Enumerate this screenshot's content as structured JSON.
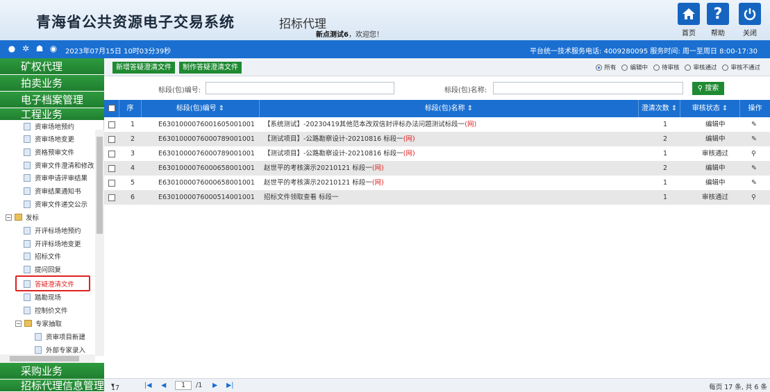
{
  "header": {
    "system_title": "青海省公共资源电子交易系统",
    "sub_title": "招标代理",
    "welcome_user": "新点测试6",
    "welcome_suffix": "，欢迎您！",
    "buttons": [
      {
        "label": "首页",
        "icon": "home-icon"
      },
      {
        "label": "帮助",
        "icon": "help-icon"
      },
      {
        "label": "关闭",
        "icon": "power-icon"
      }
    ]
  },
  "infobar": {
    "datetime": "2023年07月15日 10时03分39秒",
    "service": "平台统一技术服务电话: 4009280095 服务时间: 周一至周日 8:00-17:30"
  },
  "nav": {
    "sections_top": [
      "矿权代理",
      "拍卖业务",
      "电子档案管理",
      "工程业务"
    ],
    "sections_bottom": [
      "采购业务",
      "招标代理信息管理"
    ],
    "tree": [
      {
        "label": "资审场地预约",
        "type": "doc",
        "indent": 1
      },
      {
        "label": "资审场地变更",
        "type": "doc",
        "indent": 1
      },
      {
        "label": "资格预审文件",
        "type": "doc",
        "indent": 1
      },
      {
        "label": "资审文件澄清和修改",
        "type": "doc",
        "indent": 1
      },
      {
        "label": "资审申请评审结果",
        "type": "doc",
        "indent": 1
      },
      {
        "label": "资审结果通知书",
        "type": "doc",
        "indent": 1
      },
      {
        "label": "资审文件递交公示",
        "type": "doc",
        "indent": 1
      },
      {
        "label": "发标",
        "type": "folder",
        "indent": 0
      },
      {
        "label": "开评标场地预约",
        "type": "doc",
        "indent": 1
      },
      {
        "label": "开评标场地变更",
        "type": "doc",
        "indent": 1
      },
      {
        "label": "招标文件",
        "type": "doc",
        "indent": 1
      },
      {
        "label": "提问回复",
        "type": "doc",
        "indent": 1
      },
      {
        "label": "答疑澄清文件",
        "type": "doc",
        "indent": 1,
        "active": true
      },
      {
        "label": "踏勘现场",
        "type": "doc",
        "indent": 1
      },
      {
        "label": "控制价文件",
        "type": "doc",
        "indent": 1
      },
      {
        "label": "专家抽取",
        "type": "folder",
        "indent": 1
      },
      {
        "label": "资审项目新建",
        "type": "doc",
        "indent": 2
      },
      {
        "label": "外部专家录入",
        "type": "doc",
        "indent": 2
      }
    ]
  },
  "toolbar": {
    "add_button": "新增答疑澄清文件",
    "make_button": "制作答疑澄清文件",
    "filters": [
      {
        "label": "所有",
        "selected": true
      },
      {
        "label": "编辑中",
        "selected": false
      },
      {
        "label": "待审核",
        "selected": false
      },
      {
        "label": "审核通过",
        "selected": false
      },
      {
        "label": "审核不通过",
        "selected": false
      }
    ]
  },
  "search": {
    "code_label": "标段(包)编号:",
    "name_label": "标段(包)名称:",
    "button": "搜索"
  },
  "grid": {
    "columns": [
      "序",
      "标段(包)编号 ⇕",
      "标段(包)名称 ⇕",
      "澄清次数 ⇕",
      "审核状态 ⇕",
      "操作"
    ],
    "rows": [
      {
        "no": "1",
        "code": "E6301000076001605001001",
        "name": "【系统测试】-20230419其他范本改双信封评标办法问题测试标段一",
        "tag": "(网)",
        "times": "1",
        "status": "编辑中",
        "action": "edit-icon"
      },
      {
        "no": "2",
        "code": "E6301000076000789001001",
        "name": "【测试项目】-公路勘察设计-20210816 标段一",
        "tag": "(网)",
        "times": "2",
        "status": "编辑中",
        "action": "edit-icon"
      },
      {
        "no": "3",
        "code": "E6301000076000789001001",
        "name": "【测试项目】-公路勘察设计-20210816 标段一",
        "tag": "(网)",
        "times": "1",
        "status": "审核通过",
        "action": "search-icon"
      },
      {
        "no": "4",
        "code": "E6301000076000658001001",
        "name": "赵世平的考核演示20210121 标段一",
        "tag": "(网)",
        "times": "2",
        "status": "编辑中",
        "action": "edit-icon"
      },
      {
        "no": "5",
        "code": "E6301000076000658001001",
        "name": "赵世平的考核演示20210121 标段一",
        "tag": "(网)",
        "times": "1",
        "status": "编辑中",
        "action": "edit-icon"
      },
      {
        "no": "6",
        "code": "E6301000076000514001001",
        "name": "招标文件领取查看 标段一",
        "tag": "",
        "times": "1",
        "status": "审核通过",
        "action": "search-icon"
      }
    ]
  },
  "pager": {
    "page_size": "17",
    "current_page": "1",
    "total_pages": "/1",
    "summary": "每页 17 条, 共 6 条"
  }
}
